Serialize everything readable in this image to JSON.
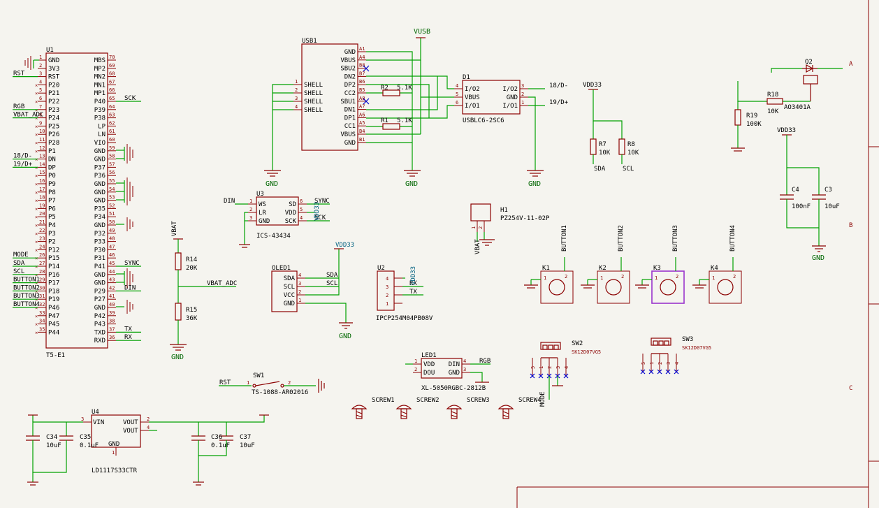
{
  "frame": {
    "col_letters": [
      "A",
      "B",
      "C"
    ]
  },
  "u1": {
    "ref": "U1",
    "value": "T5-E1",
    "left_pins": [
      {
        "num": "1",
        "name": "GND"
      },
      {
        "num": "2",
        "name": "3V3"
      },
      {
        "num": "3",
        "name": "RST"
      },
      {
        "num": "4",
        "name": "P20"
      },
      {
        "num": "5",
        "name": "P21"
      },
      {
        "num": "6",
        "name": "P22"
      },
      {
        "num": "7",
        "name": "P23"
      },
      {
        "num": "8",
        "name": "P24"
      },
      {
        "num": "9",
        "name": "P25"
      },
      {
        "num": "10",
        "name": "P26"
      },
      {
        "num": "11",
        "name": "P28"
      },
      {
        "num": "12",
        "name": "P1"
      },
      {
        "num": "13",
        "name": "DN"
      },
      {
        "num": "14",
        "name": "DP"
      },
      {
        "num": "15",
        "name": "P0"
      },
      {
        "num": "16",
        "name": "P9"
      },
      {
        "num": "17",
        "name": "P8"
      },
      {
        "num": "18",
        "name": "P7"
      },
      {
        "num": "19",
        "name": "P6"
      },
      {
        "num": "20",
        "name": "P5"
      },
      {
        "num": "21",
        "name": "P4"
      },
      {
        "num": "22",
        "name": "P3"
      },
      {
        "num": "23",
        "name": "P2"
      },
      {
        "num": "24",
        "name": "P12"
      },
      {
        "num": "26",
        "name": "P15"
      },
      {
        "num": "27",
        "name": "P14"
      },
      {
        "num": "28",
        "name": "P16"
      },
      {
        "num": "29",
        "name": "P17"
      },
      {
        "num": "30",
        "name": "P18"
      },
      {
        "num": "31",
        "name": "P19"
      },
      {
        "num": "32",
        "name": "P46"
      },
      {
        "num": "33",
        "name": "P47"
      },
      {
        "num": "34",
        "name": "P45"
      },
      {
        "num": "35",
        "name": "P44"
      }
    ],
    "right_pins": [
      {
        "num": "70",
        "name": "MBS"
      },
      {
        "num": "69",
        "name": "MP2"
      },
      {
        "num": "68",
        "name": "MN2"
      },
      {
        "num": "67",
        "name": "MN1"
      },
      {
        "num": "66",
        "name": "MP1"
      },
      {
        "num": "65",
        "name": "P40"
      },
      {
        "num": "64",
        "name": "P39"
      },
      {
        "num": "63",
        "name": "P38"
      },
      {
        "num": "62",
        "name": "LP"
      },
      {
        "num": "61",
        "name": "LN"
      },
      {
        "num": "60",
        "name": "VIO"
      },
      {
        "num": "59",
        "name": "GND"
      },
      {
        "num": "58",
        "name": "GND"
      },
      {
        "num": "57",
        "name": "P37"
      },
      {
        "num": "56",
        "name": "P36"
      },
      {
        "num": "55",
        "name": "GND"
      },
      {
        "num": "54",
        "name": "GND"
      },
      {
        "num": "53",
        "name": "GND"
      },
      {
        "num": "52",
        "name": "P35"
      },
      {
        "num": "51",
        "name": "P34"
      },
      {
        "num": "50",
        "name": "GND"
      },
      {
        "num": "49",
        "name": "P32"
      },
      {
        "num": "48",
        "name": "P33"
      },
      {
        "num": "47",
        "name": "P30"
      },
      {
        "num": "46",
        "name": "P31"
      },
      {
        "num": "45",
        "name": "P41"
      },
      {
        "num": "44",
        "name": "GND"
      },
      {
        "num": "43",
        "name": "GND"
      },
      {
        "num": "42",
        "name": "P29"
      },
      {
        "num": "41",
        "name": "P27"
      },
      {
        "num": "40",
        "name": "GND"
      },
      {
        "num": "39",
        "name": "P42"
      },
      {
        "num": "38",
        "name": "P43"
      },
      {
        "num": "37",
        "name": "TXD"
      },
      {
        "num": "36",
        "name": "RXD"
      }
    ],
    "left_labels": [
      {
        "row": 2,
        "text": "RST"
      },
      {
        "row": 6,
        "text": "RGB"
      },
      {
        "row": 7,
        "text": "VBAT_ADC"
      },
      {
        "row": 12,
        "text": "18/D-"
      },
      {
        "row": 13,
        "text": "19/D+"
      },
      {
        "row": 24,
        "text": "MODE"
      },
      {
        "row": 25,
        "text": "SDA"
      },
      {
        "row": 26,
        "text": "SCL"
      },
      {
        "row": 27,
        "text": "BUTTON1"
      },
      {
        "row": 28,
        "text": "BUTTON2"
      },
      {
        "row": 29,
        "text": "BUTTON3"
      },
      {
        "row": 30,
        "text": "BUTTON4"
      }
    ],
    "right_labels": [
      {
        "row": 5,
        "text": "SCK"
      },
      {
        "row": 25,
        "text": "SYNC"
      },
      {
        "row": 28,
        "text": "DIN"
      },
      {
        "row": 33,
        "text": "TX"
      },
      {
        "row": 34,
        "text": "RX"
      }
    ]
  },
  "usb1": {
    "ref": "USB1",
    "shell_pins": [
      {
        "num": "1",
        "name": "SHELL"
      },
      {
        "num": "2",
        "name": "SHELL"
      },
      {
        "num": "3",
        "name": "SHELL"
      },
      {
        "num": "4",
        "name": "SHELL"
      }
    ],
    "right_pins": [
      {
        "num": "A1",
        "name": "GND"
      },
      {
        "num": "A4",
        "name": "VBUS"
      },
      {
        "num": "B8",
        "name": "SBU2"
      },
      {
        "num": "B7",
        "name": "DN2"
      },
      {
        "num": "B6",
        "name": "DP2"
      },
      {
        "num": "B5",
        "name": "CC2"
      },
      {
        "num": "A8",
        "name": "SBU1"
      },
      {
        "num": "A7",
        "name": "DN1"
      },
      {
        "num": "A6",
        "name": "DP1"
      },
      {
        "num": "A5",
        "name": "CC1"
      },
      {
        "num": "B4",
        "name": "VBUS"
      },
      {
        "num": "B1",
        "name": "GND"
      }
    ],
    "net": "VUSB",
    "gnd_left": "GND",
    "gnd_right": "GND"
  },
  "r2": {
    "ref": "R2",
    "value": "5.1K"
  },
  "r1": {
    "ref": "R1",
    "value": "5.1K"
  },
  "d1": {
    "ref": "D1",
    "value": "USBLC6-2SC6",
    "left_pins": [
      {
        "num": "4",
        "name": "I/O2"
      },
      {
        "num": "5",
        "name": "VBUS"
      },
      {
        "num": "6",
        "name": "I/O1"
      }
    ],
    "right_pins": [
      {
        "num": "3",
        "name": "I/O2"
      },
      {
        "num": "2",
        "name": "GND"
      },
      {
        "num": "1",
        "name": "I/O1"
      }
    ],
    "labels": [
      "18/D-",
      "19/D+"
    ],
    "gnd": "GND"
  },
  "r7": {
    "ref": "R7",
    "value": "10K",
    "net": "SDA"
  },
  "r8": {
    "ref": "R8",
    "value": "10K",
    "net": "SCL"
  },
  "i2c_pull_net": "VDD33",
  "q2": {
    "ref": "Q2",
    "value": "AO3401A"
  },
  "r18": {
    "ref": "R18",
    "value": "10K"
  },
  "r19": {
    "ref": "R19",
    "value": "100K"
  },
  "c4": {
    "ref": "C4",
    "value": "100nF"
  },
  "c3": {
    "ref": "C3",
    "value": "10uF"
  },
  "decap_net": "VDD33",
  "decap_gnd": "GND",
  "h1": {
    "ref": "H1",
    "value": "PZ254V-11-02P",
    "pins": [
      "1",
      "2"
    ],
    "net": "VBAT"
  },
  "u3": {
    "ref": "U3",
    "value": "ICS-43434",
    "left_pins": [
      {
        "num": "1",
        "name": "WS"
      },
      {
        "num": "2",
        "name": "LR"
      },
      {
        "num": "3",
        "name": "GND"
      }
    ],
    "right_pins": [
      {
        "num": "6",
        "name": "SD"
      },
      {
        "num": "5",
        "name": "VDD"
      },
      {
        "num": "4",
        "name": "SCK"
      }
    ],
    "labels": {
      "din": "DIN",
      "sync": "SYNC",
      "sck": "SCK",
      "vdd": "VDD33"
    }
  },
  "oled1": {
    "ref": "OLED1",
    "pins": [
      {
        "num": "4",
        "name": "SDA"
      },
      {
        "num": "3",
        "name": "SCL"
      },
      {
        "num": "2",
        "name": "VCC"
      },
      {
        "num": "1",
        "name": "GND"
      }
    ],
    "labels": [
      "SDA",
      "SCL"
    ],
    "net": "VDD33",
    "gnd": "GND"
  },
  "u2": {
    "ref": "U2",
    "value": "IPCP254M04PB08V",
    "pins": [
      "4",
      "3",
      "2",
      "1"
    ],
    "labels": [
      "RX",
      "TX"
    ],
    "net": "VDD33"
  },
  "vbat_div": {
    "net": "VBAT",
    "label": "VBAT_ADC",
    "gnd": "GND",
    "r14": {
      "ref": "R14",
      "value": "20K"
    },
    "r15": {
      "ref": "R15",
      "value": "36K"
    }
  },
  "buttons": [
    {
      "ref": "K1",
      "label": "BUTTON1",
      "pins": [
        "1",
        "2"
      ]
    },
    {
      "ref": "K2",
      "label": "BUTTON2",
      "pins": [
        "1",
        "2"
      ]
    },
    {
      "ref": "K3",
      "label": "BUTTON3",
      "pins": [
        "1",
        "2"
      ]
    },
    {
      "ref": "K4",
      "label": "BUTTON4",
      "pins": [
        "1",
        "2"
      ]
    }
  ],
  "sw1": {
    "ref": "SW1",
    "value": "TS-1088-AR02016",
    "net": "RST",
    "pins": [
      "1",
      "2"
    ]
  },
  "led1": {
    "ref": "LED1",
    "value": "XL-5050RGBC-2812B",
    "left_pins": [
      {
        "num": "1",
        "name": "VDD"
      },
      {
        "num": "2",
        "name": "DOU"
      }
    ],
    "right_pins": [
      {
        "num": "4",
        "name": "DIN"
      },
      {
        "num": "3",
        "name": "GND"
      }
    ],
    "label": "RGB"
  },
  "sw2": {
    "ref": "SW2",
    "value": "SK12D07VG5",
    "pins": [
      "5",
      "1",
      "2",
      "3",
      "4"
    ],
    "label": "MODE"
  },
  "sw3": {
    "ref": "SW3",
    "value": "SK12D07VG5",
    "pins": [
      "5",
      "1",
      "2",
      "3",
      "4"
    ]
  },
  "screws": [
    "SCREW1",
    "SCREW2",
    "SCREW3",
    "SCREW4"
  ],
  "u4": {
    "ref": "U4",
    "value": "LD1117S33CTR",
    "left_pins": [
      {
        "num": "3",
        "name": "VIN"
      }
    ],
    "right_pins": [
      {
        "num": "2",
        "name": "VOUT"
      },
      {
        "num": "4",
        "name": "VOUT"
      }
    ],
    "bottom_pin": {
      "num": "1",
      "name": "GND"
    }
  },
  "c34": {
    "ref": "C34",
    "value": "10uF"
  },
  "c35": {
    "ref": "C35",
    "value": "0.1uF"
  },
  "c36": {
    "ref": "C36",
    "value": "0.1uF"
  },
  "c37": {
    "ref": "C37",
    "value": "10uF"
  }
}
